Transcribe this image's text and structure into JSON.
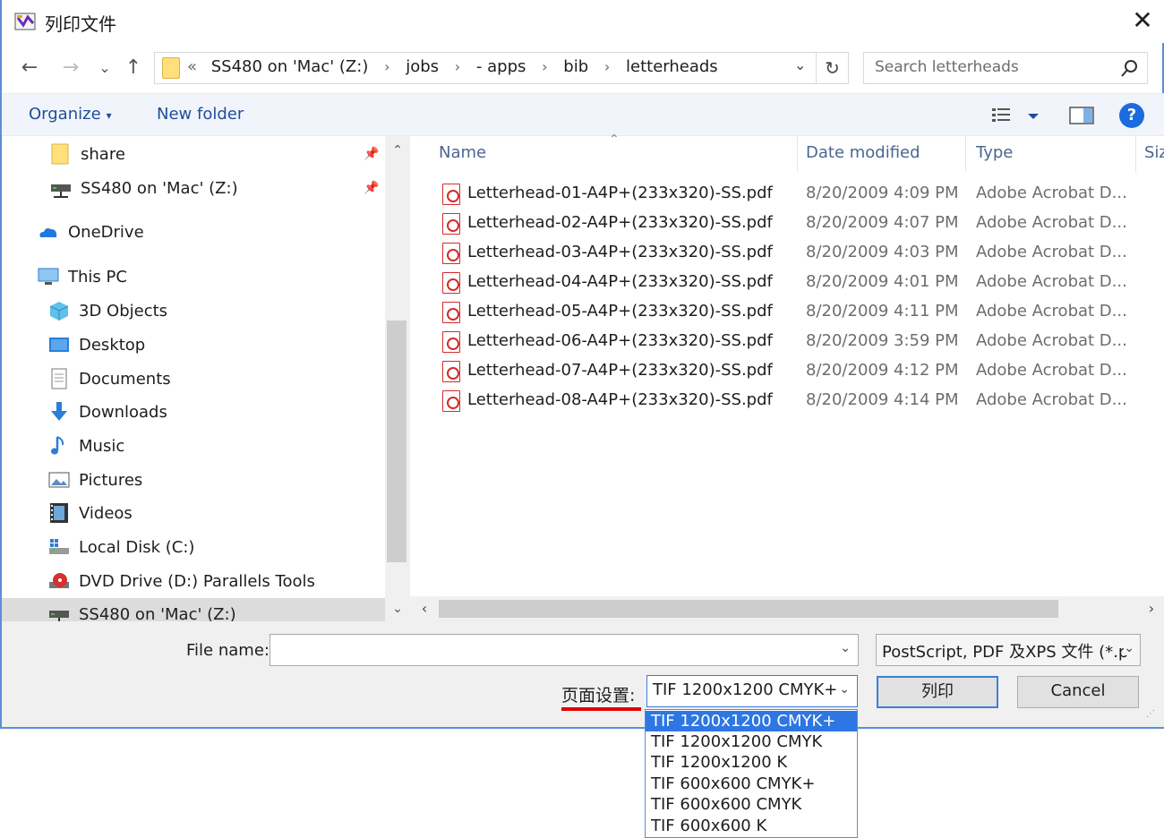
{
  "window": {
    "title": "列印文件",
    "close_glyph": "✕"
  },
  "nav": {
    "back_glyph": "←",
    "forward_glyph": "→",
    "recent_glyph": "⌄",
    "up_glyph": "↑",
    "breadcrumb_prefix": "«",
    "breadcrumbs": [
      "SS480 on 'Mac' (Z:)",
      "jobs",
      "- apps",
      "bib",
      "letterheads"
    ],
    "separator": "›",
    "dropdown_glyph": "⌄",
    "refresh_glyph": "↻",
    "search_placeholder": "Search letterheads"
  },
  "toolbar": {
    "organize_label": "Organize",
    "new_folder_label": "New folder",
    "help_glyph": "?",
    "views_caret": "▾"
  },
  "sidebar": {
    "items": [
      {
        "label": "share",
        "icon": "folder-icon"
      },
      {
        "label": "SS480 on 'Mac' (Z:)",
        "icon": "network-drive-icon"
      },
      {
        "label": "OneDrive",
        "icon": "onedrive-icon"
      },
      {
        "label": "This PC",
        "icon": "computer-icon"
      },
      {
        "label": "3D Objects",
        "icon": "3d-objects-icon"
      },
      {
        "label": "Desktop",
        "icon": "desktop-icon"
      },
      {
        "label": "Documents",
        "icon": "documents-icon"
      },
      {
        "label": "Downloads",
        "icon": "downloads-icon"
      },
      {
        "label": "Music",
        "icon": "music-icon"
      },
      {
        "label": "Pictures",
        "icon": "pictures-icon"
      },
      {
        "label": "Videos",
        "icon": "videos-icon"
      },
      {
        "label": "Local Disk (C:)",
        "icon": "local-disk-icon"
      },
      {
        "label": "DVD Drive (D:) Parallels Tools",
        "icon": "dvd-drive-icon"
      },
      {
        "label": "SS480 on 'Mac' (Z:)",
        "icon": "network-drive-icon"
      }
    ],
    "scroll_up_glyph": "⌃",
    "scroll_down_glyph": "⌄"
  },
  "columns": {
    "name": "Name",
    "date": "Date modified",
    "type": "Type",
    "size": "Siz",
    "sort_glyph": "⌃"
  },
  "files": [
    {
      "name": "Letterhead-01-A4P+(233x320)-SS.pdf",
      "date": "8/20/2009 4:09 PM",
      "type": "Adobe Acrobat D..."
    },
    {
      "name": "Letterhead-02-A4P+(233x320)-SS.pdf",
      "date": "8/20/2009 4:07 PM",
      "type": "Adobe Acrobat D..."
    },
    {
      "name": "Letterhead-03-A4P+(233x320)-SS.pdf",
      "date": "8/20/2009 4:03 PM",
      "type": "Adobe Acrobat D..."
    },
    {
      "name": "Letterhead-04-A4P+(233x320)-SS.pdf",
      "date": "8/20/2009 4:01 PM",
      "type": "Adobe Acrobat D..."
    },
    {
      "name": "Letterhead-05-A4P+(233x320)-SS.pdf",
      "date": "8/20/2009 4:11 PM",
      "type": "Adobe Acrobat D..."
    },
    {
      "name": "Letterhead-06-A4P+(233x320)-SS.pdf",
      "date": "8/20/2009 3:59 PM",
      "type": "Adobe Acrobat D..."
    },
    {
      "name": "Letterhead-07-A4P+(233x320)-SS.pdf",
      "date": "8/20/2009 4:12 PM",
      "type": "Adobe Acrobat D..."
    },
    {
      "name": "Letterhead-08-A4P+(233x320)-SS.pdf",
      "date": "8/20/2009 4:14 PM",
      "type": "Adobe Acrobat D..."
    }
  ],
  "hscroll": {
    "left_glyph": "‹",
    "right_glyph": "›"
  },
  "bottom": {
    "file_name_label": "File name:",
    "file_name_value": "",
    "file_type_value": "PostScript, PDF 及XPS 文件 (*.p",
    "page_setup_label": "页面设置:",
    "page_setup_value": "TIF 1200x1200 CMYK+",
    "print_label": "列印",
    "cancel_label": "Cancel",
    "drop_glyph": "⌄"
  },
  "page_setup_options": [
    "TIF 1200x1200 CMYK+",
    "TIF 1200x1200 CMYK",
    "TIF 1200x1200 K",
    "TIF 600x600 CMYK+",
    "TIF 600x600 CMYK",
    "TIF 600x600 K"
  ],
  "colors": {
    "accent": "#1f4e9a",
    "selection": "#2e76e3",
    "highlight_line": "#e00000",
    "pdf_red": "#d42a2a"
  }
}
